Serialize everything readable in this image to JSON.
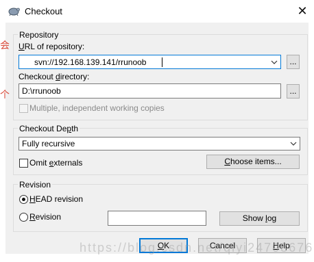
{
  "window": {
    "title": "Checkout",
    "close_icon": "close-icon",
    "app_icon": "tortoisesvn-icon"
  },
  "repository": {
    "group_title": "Repository",
    "url_label_pre": "",
    "url_label_u": "U",
    "url_label_post": "RL of repository:",
    "url_value": "svn://192.168.139.141/rrunoob",
    "url_browse": "...",
    "dir_label_pre": "Checkout ",
    "dir_label_u": "d",
    "dir_label_post": "irectory:",
    "dir_value": "D:\\rrunoob",
    "dir_browse": "...",
    "multiple_label": "Multiple, independent working copies",
    "multiple_checked": false
  },
  "depth": {
    "group_title_pre": "Checkout De",
    "group_title_u": "p",
    "group_title_post": "th",
    "selected": "Fully recursive",
    "omit_externals_pre": "Omit ",
    "omit_externals_u": "e",
    "omit_externals_post": "xternals",
    "omit_externals_checked": false,
    "choose_items_pre": "",
    "choose_items_u": "C",
    "choose_items_post": "hoose items..."
  },
  "revision": {
    "group_title": "Revision",
    "head_pre": "",
    "head_u": "H",
    "head_post": "EAD revision",
    "head_selected": true,
    "rev_pre": "",
    "rev_u": "R",
    "rev_post": "evision",
    "rev_value": "",
    "show_log_pre": "Show ",
    "show_log_u": "l",
    "show_log_post": "og"
  },
  "buttons": {
    "ok_pre": "",
    "ok_u": "O",
    "ok_post": "K",
    "cancel": "Cancel",
    "help_pre": "",
    "help_u": "H",
    "help_post": "elp"
  },
  "background": {
    "side_chars": [
      "会",
      "个"
    ],
    "watermark": "https://blog.csdn.net/qiyi24708676"
  }
}
